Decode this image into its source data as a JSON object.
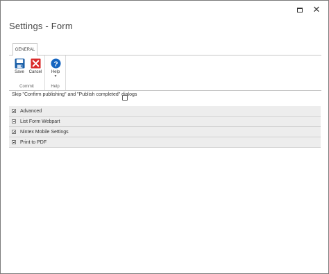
{
  "window": {
    "title": "Settings - Form"
  },
  "ribbon": {
    "tab_label": "GENERAL",
    "groups": [
      {
        "label": "Commit",
        "buttons": [
          {
            "label": "Save",
            "icon": "save-icon"
          },
          {
            "label": "Cancel",
            "icon": "cancel-icon"
          }
        ]
      },
      {
        "label": "Help",
        "buttons": [
          {
            "label": "Help",
            "icon": "help-icon"
          }
        ]
      }
    ]
  },
  "options": {
    "skip_dialogs_label": "Skip \"Confirm publishing\" and \"Publish completed\" dialogs",
    "skip_dialogs_checked": false
  },
  "sections": [
    {
      "label": "Advanced"
    },
    {
      "label": "List Form Webpart"
    },
    {
      "label": "Nintex Mobile Settings"
    },
    {
      "label": "Print to PDF"
    }
  ],
  "colors": {
    "save_icon": "#1a5fa8",
    "cancel_icon": "#d92b2b",
    "help_icon": "#1565c0",
    "section_bg": "#ededed"
  }
}
